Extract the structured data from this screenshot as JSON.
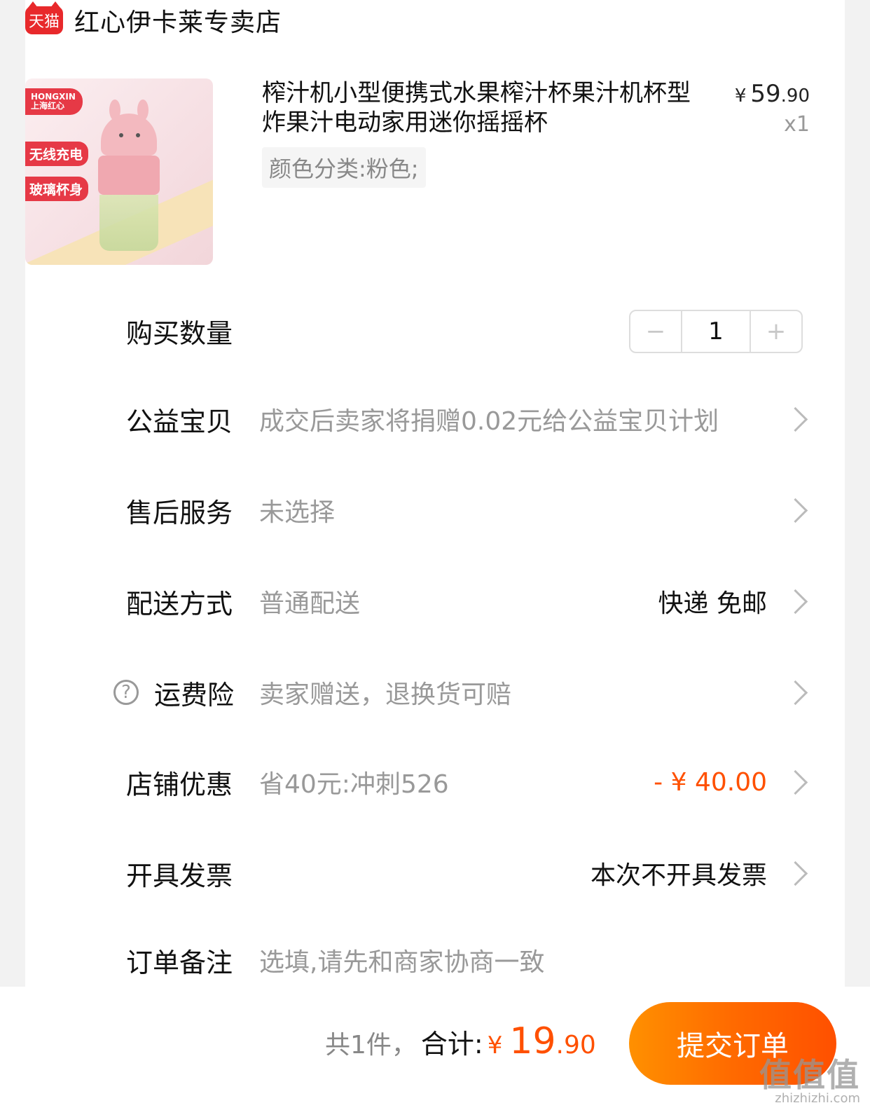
{
  "shop": {
    "badge": "天猫",
    "name": "红心伊卡莱专卖店"
  },
  "product": {
    "image": {
      "brand": "HONGXIN",
      "brand_sub": "上海红心",
      "tag1": "无线充电",
      "tag2": "玻璃杯身"
    },
    "title": "榨汁机小型便携式水果榨汁杯果汁机杯型炸果汁电动家用迷你摇摇杯",
    "price_symbol": "¥",
    "price_int": "59",
    "price_dec": ".90",
    "quantity_text": "x1",
    "sku": "颜色分类:粉色;"
  },
  "rows": {
    "quantity": {
      "label": "购买数量",
      "minus": "−",
      "value": "1",
      "plus": "+"
    },
    "charity": {
      "label": "公益宝贝",
      "value": "成交后卖家将捐赠0.02元给公益宝贝计划"
    },
    "after_sales": {
      "label": "售后服务",
      "value": "未选择"
    },
    "delivery": {
      "label": "配送方式",
      "value": "普通配送",
      "right": "快递 免邮"
    },
    "insurance": {
      "icon": "?",
      "label": "运费险",
      "value": "卖家赠送，退换货可赔"
    },
    "discount": {
      "label": "店铺优惠",
      "value": "省40元:冲刺526",
      "right": "- ¥ 40.00",
      "right_color": "#ff5000"
    },
    "invoice": {
      "label": "开具发票",
      "right": "本次不开具发票"
    },
    "note": {
      "label": "订单备注",
      "placeholder": "选填,请先和商家协商一致"
    }
  },
  "footer": {
    "count": "共1件，",
    "total_label": "合计:",
    "yen": "¥",
    "total_int": "19",
    "total_dec": ".90",
    "submit_label": "提交订单",
    "submit_color": "#ff6a00"
  },
  "watermark": {
    "main": "值值值",
    "sub": "zhizhizhi.com"
  }
}
